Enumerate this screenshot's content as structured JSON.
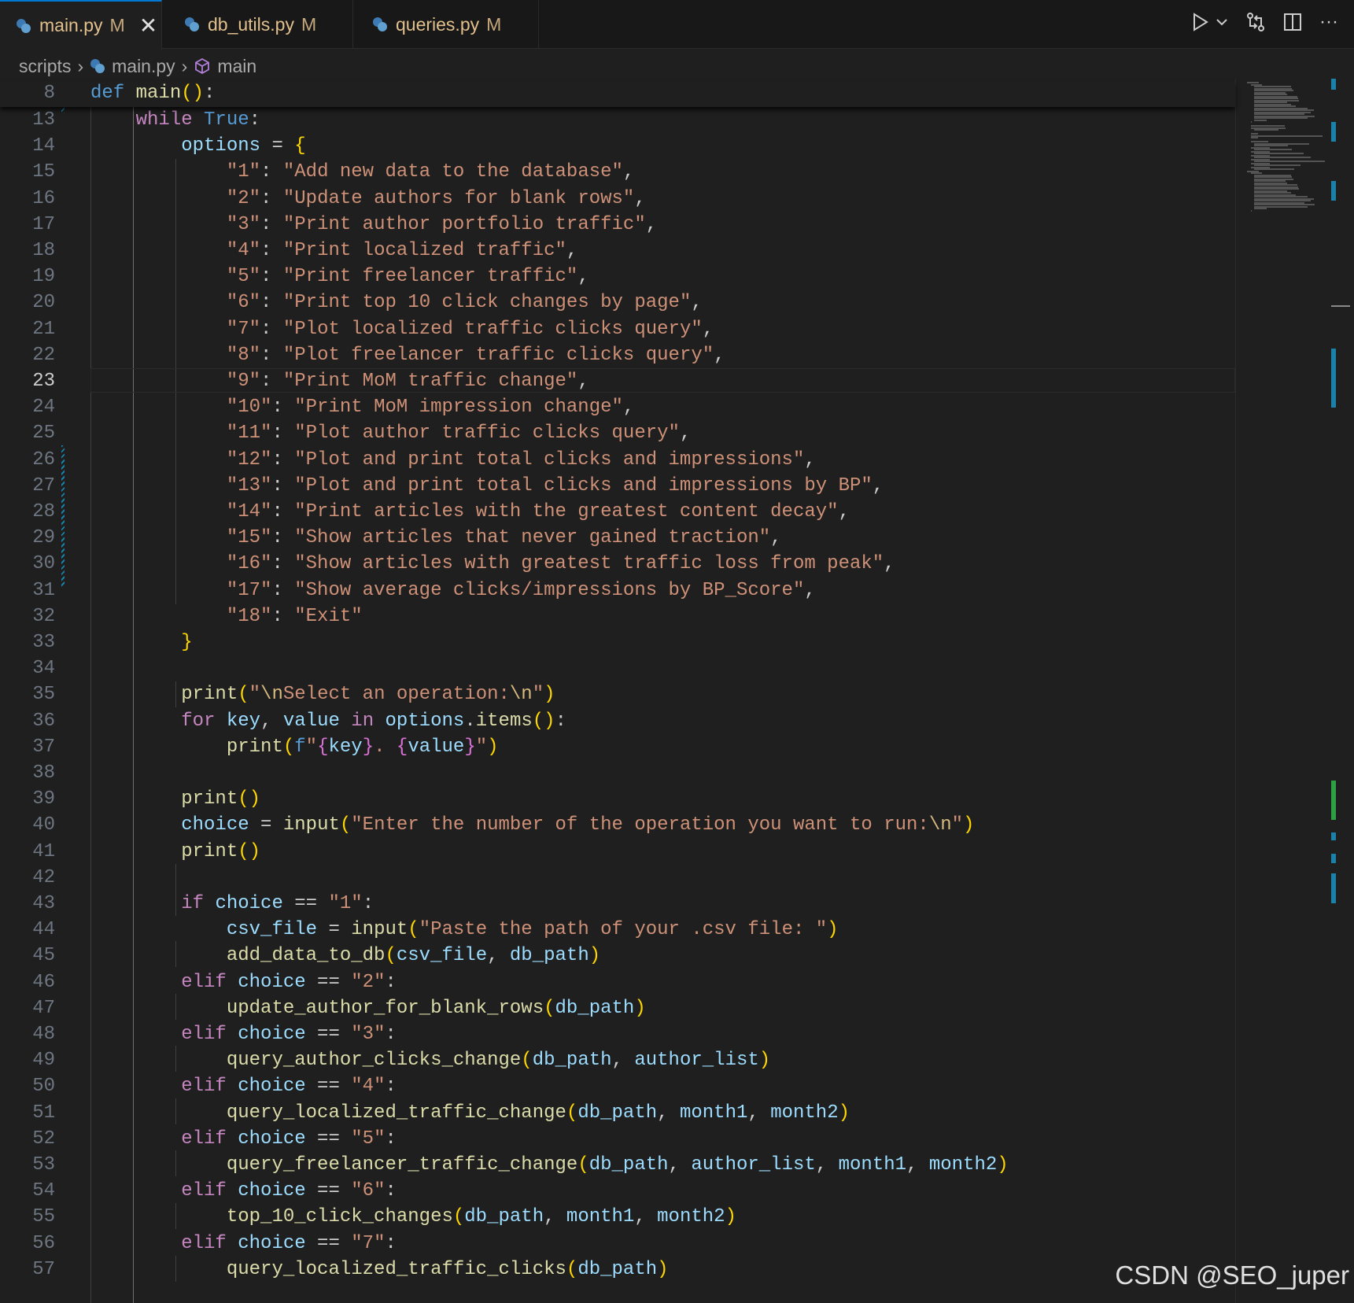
{
  "tabs": [
    {
      "name": "main.py",
      "mod": "M",
      "active": true
    },
    {
      "name": "db_utils.py",
      "mod": "M",
      "active": false
    },
    {
      "name": "queries.py",
      "mod": "M",
      "active": false
    }
  ],
  "breadcrumb": {
    "folder": "scripts",
    "file": "main.py",
    "symbol": "main"
  },
  "sticky": {
    "line": "8",
    "code": "def main():"
  },
  "editor": {
    "current_line": 23
  },
  "watermark": "CSDN @SEO_juper"
}
